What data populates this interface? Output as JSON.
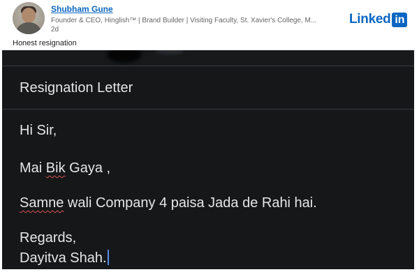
{
  "post": {
    "author_name": "Shubham Gune",
    "author_headline": "Founder & CEO, Hinglish™ | Brand Builder | Visiting Faculty, St. Xavier's College, M...",
    "time_ago": "2d",
    "text": "Honest resignation",
    "logo_word": "Linked",
    "logo_box": "in"
  },
  "letter": {
    "subject": "Resignation Letter",
    "greeting": "Hi Sir,",
    "line1_a": "Mai ",
    "line1_b": "Bik",
    "line1_c": " Gaya ,",
    "line2_a": "Samne",
    "line2_b": " wali Company 4 paisa Jada de Rahi hai.",
    "closing": "Regards,",
    "signature": "Dayitva Shah."
  },
  "colors": {
    "brand": "#0a66c2",
    "image_background": "#151719",
    "letter_text": "#e6e6e6",
    "spellcheck_underline": "#d9534f",
    "caret": "#5b8def"
  },
  "icons": {
    "logo": "linkedin-logo",
    "avatar": "profile-photo"
  }
}
